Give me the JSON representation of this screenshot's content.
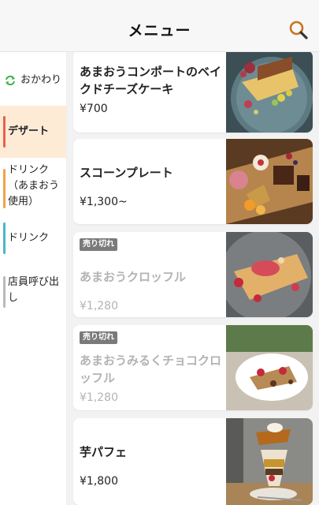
{
  "header": {
    "title": "メニュー",
    "search_icon": "search-icon",
    "accent": "#c8741d"
  },
  "sidebar": {
    "items": [
      {
        "label": "おかわり",
        "icon": "refresh-icon",
        "color": "#3bb34a"
      },
      {
        "label": "デザート",
        "active": true,
        "color": "#e8614c"
      },
      {
        "label": "ドリンク（あまおう使用）",
        "line1": "ドリンク",
        "line2": "（あまおう",
        "line3": "使用）",
        "color": "#f0a34a"
      },
      {
        "label": "ドリンク",
        "color": "#4ab6c9"
      },
      {
        "label": "店員呼び出し",
        "line1": "店員呼び出",
        "line2": "し"
      }
    ]
  },
  "menu": {
    "items": [
      {
        "name_line1": "あまおうコンポートのベイ",
        "name_line2": "クドチーズケーキ",
        "price": "¥700",
        "sold_out": false
      },
      {
        "name_line1": "スコーンプレート",
        "price": "¥1,300~",
        "sold_out": false
      },
      {
        "name_line1": "あまおうクロッフル",
        "price": "¥1,280",
        "sold_out": true,
        "badge": "売り切れ"
      },
      {
        "name_line1": "あまおうみるくチョコクロ",
        "name_line2": "ッフル",
        "price": "¥1,280",
        "sold_out": true,
        "badge": "売り切れ"
      },
      {
        "name_line1": "芋パフェ",
        "price": "¥1,800",
        "sold_out": false
      }
    ]
  }
}
